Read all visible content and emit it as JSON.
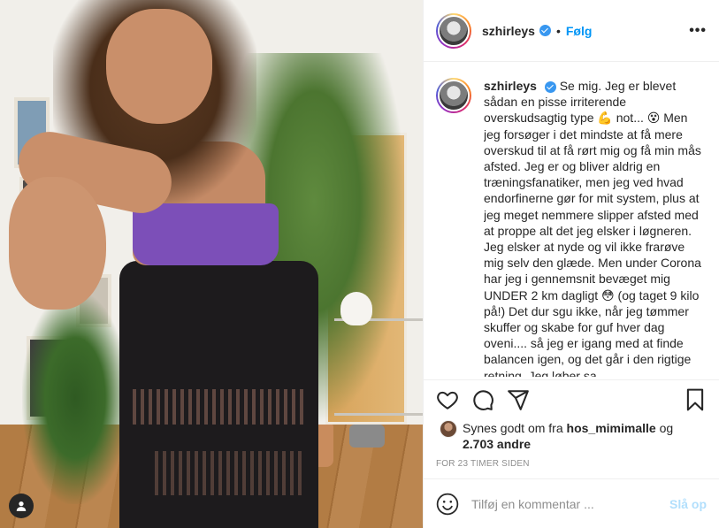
{
  "post": {
    "username": "szhirleys",
    "follow_label": "Følg",
    "separator": "•",
    "more_label": "•••"
  },
  "caption": {
    "username": "szhirleys",
    "text": "Se mig. Jeg er blevet sådan en pisse irriterende overskudsagtig type 💪 not... 😵 Men jeg forsøger i det mindste at få mere overskud til at få rørt mig og få min mås afsted. Jeg er og bliver aldrig en træningsfanatiker, men jeg ved hvad endorfinerne gør for mit system, plus at jeg meget nemmere slipper afsted med at proppe alt det jeg elsker i løgneren. Jeg elsker at nyde og vil ikke frarøve mig selv den glæde. Men under Corona har jeg i gennemsnit bevæget mig UNDER 2 km dagligt 😳 (og taget 9 kilo på!) Det dur sgu ikke, når jeg tømmer skuffer og skabe for guf hver dag oveni.... så jeg er igang med at finde balancen igen, og det går i den rigtige retning. Jeg løber sa"
  },
  "likes": {
    "prefix": "Synes godt om fra",
    "liker": "hos_mimimalle",
    "connector": "og",
    "count": "2.703 andre"
  },
  "timestamp": "FOR 23 TIMER SIDEN",
  "comment": {
    "placeholder": "Tilføj en kommentar ...",
    "post_label": "Slå op"
  },
  "icons": {
    "like": "heart-icon",
    "comment": "comment-icon",
    "share": "share-icon",
    "save": "bookmark-icon",
    "emoji": "emoji-icon",
    "tag": "user-tag-icon"
  },
  "colors": {
    "follow": "#0095f6",
    "verified": "#3897f0",
    "post_disabled": "#b2dffc",
    "muted": "#8e8e8e"
  }
}
